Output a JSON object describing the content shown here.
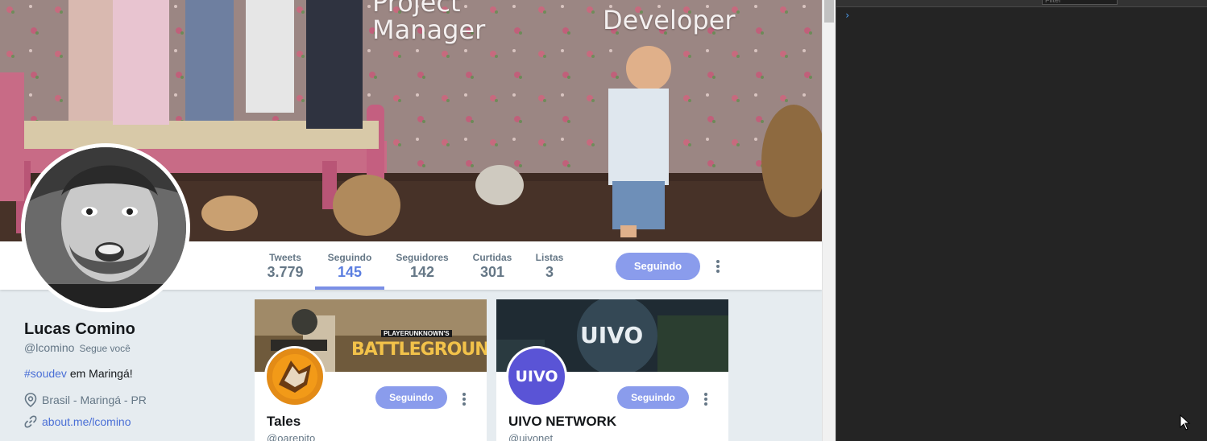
{
  "banner": {
    "title_left": "Project\nManager",
    "title_right": "Developer"
  },
  "profile_nav": {
    "stats": [
      {
        "label": "Tweets",
        "value": "3.779",
        "active": false
      },
      {
        "label": "Seguindo",
        "value": "145",
        "active": true
      },
      {
        "label": "Seguidores",
        "value": "142",
        "active": false
      },
      {
        "label": "Curtidas",
        "value": "301",
        "active": false
      },
      {
        "label": "Listas",
        "value": "3",
        "active": false
      }
    ],
    "follow_button_label": "Seguindo"
  },
  "profile": {
    "name": "Lucas Comino",
    "handle": "@lcomino",
    "follows_you": "Segue você",
    "bio_hashtag": "#soudev",
    "bio_rest": " em Maringá!",
    "location": "Brasil - Maringá - PR",
    "link": "about.me/lcomino"
  },
  "following_cards": [
    {
      "name": "Tales",
      "handle": "@oarepito",
      "follow_label": "Seguindo",
      "banner_text": "BATTLEGROUNDS",
      "banner_subtext": "PLAYERUNKNOWN'S"
    },
    {
      "name": "UIVO NETWORK",
      "handle": "@uivonet",
      "follow_label": "Seguindo",
      "avatar_text": "UIVO",
      "banner_text": "UIVO"
    }
  ],
  "devtools": {
    "filter_placeholder": "Filter",
    "prompt": "›"
  },
  "colors": {
    "accent": "#8a9cec",
    "link": "#4a6fd6",
    "text_secondary": "#657786",
    "page_bg": "#e6ecf0",
    "devtools_bg": "#242424"
  }
}
